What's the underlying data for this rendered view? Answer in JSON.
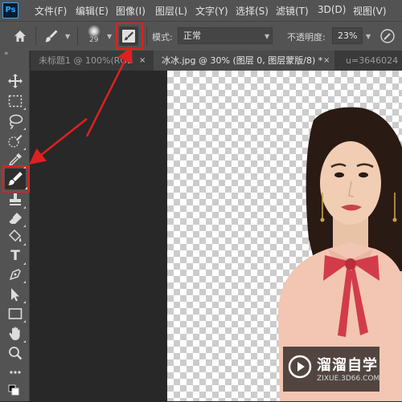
{
  "app": {
    "logo_text": "Ps",
    "brand_color": "#31a8ff"
  },
  "menu": {
    "items": [
      "文件(F)",
      "编辑(E)",
      "图像(I)",
      "图层(L)",
      "文字(Y)",
      "选择(S)",
      "滤镜(T)",
      "3D(D)",
      "视图(V)"
    ]
  },
  "options": {
    "brush_size": "29",
    "mode_label": "模式:",
    "mode_value": "正常",
    "opacity_label": "不透明度:",
    "opacity_value": "23%"
  },
  "tabs": [
    {
      "label": "未标题1 @ 100%(RGB",
      "close": "×",
      "active": false
    },
    {
      "label": "冰冰.jpg @ 30% (图层 0, 图层蒙版/8) *",
      "close": "×",
      "active": true
    },
    {
      "label": "u=3646024",
      "close": "",
      "active": false
    }
  ],
  "toolbar": {
    "collapse": "»",
    "tools": [
      "move-tool",
      "marquee-tool",
      "lasso-tool",
      "quick-selection-tool",
      "eyedropper-tool",
      "brush-tool",
      "clone-stamp-tool",
      "eraser-tool",
      "paint-bucket-tool",
      "type-tool",
      "pen-tool",
      "path-selection-tool",
      "rectangle-tool",
      "hand-tool",
      "zoom-tool",
      "more-tools"
    ],
    "selected_tool": "brush-tool",
    "type_glyph": "T"
  },
  "annotation_color": "#e02020",
  "watermark": {
    "title": "溜溜自学",
    "url": "ZIXUE.3D66.COM"
  }
}
